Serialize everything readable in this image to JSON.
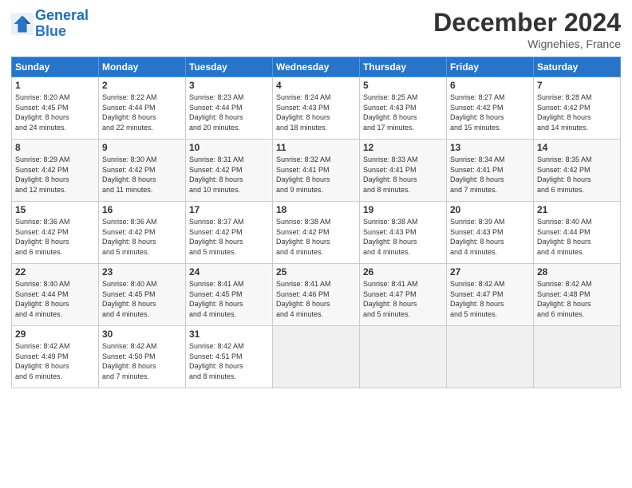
{
  "header": {
    "logo_line1": "General",
    "logo_line2": "Blue",
    "month": "December 2024",
    "location": "Wignehies, France"
  },
  "days_of_week": [
    "Sunday",
    "Monday",
    "Tuesday",
    "Wednesday",
    "Thursday",
    "Friday",
    "Saturday"
  ],
  "weeks": [
    [
      {
        "day": "1",
        "lines": [
          "Sunrise: 8:20 AM",
          "Sunset: 4:45 PM",
          "Daylight: 8 hours",
          "and 24 minutes."
        ]
      },
      {
        "day": "2",
        "lines": [
          "Sunrise: 8:22 AM",
          "Sunset: 4:44 PM",
          "Daylight: 8 hours",
          "and 22 minutes."
        ]
      },
      {
        "day": "3",
        "lines": [
          "Sunrise: 8:23 AM",
          "Sunset: 4:44 PM",
          "Daylight: 8 hours",
          "and 20 minutes."
        ]
      },
      {
        "day": "4",
        "lines": [
          "Sunrise: 8:24 AM",
          "Sunset: 4:43 PM",
          "Daylight: 8 hours",
          "and 18 minutes."
        ]
      },
      {
        "day": "5",
        "lines": [
          "Sunrise: 8:25 AM",
          "Sunset: 4:43 PM",
          "Daylight: 8 hours",
          "and 17 minutes."
        ]
      },
      {
        "day": "6",
        "lines": [
          "Sunrise: 8:27 AM",
          "Sunset: 4:42 PM",
          "Daylight: 8 hours",
          "and 15 minutes."
        ]
      },
      {
        "day": "7",
        "lines": [
          "Sunrise: 8:28 AM",
          "Sunset: 4:42 PM",
          "Daylight: 8 hours",
          "and 14 minutes."
        ]
      }
    ],
    [
      {
        "day": "8",
        "lines": [
          "Sunrise: 8:29 AM",
          "Sunset: 4:42 PM",
          "Daylight: 8 hours",
          "and 12 minutes."
        ]
      },
      {
        "day": "9",
        "lines": [
          "Sunrise: 8:30 AM",
          "Sunset: 4:42 PM",
          "Daylight: 8 hours",
          "and 11 minutes."
        ]
      },
      {
        "day": "10",
        "lines": [
          "Sunrise: 8:31 AM",
          "Sunset: 4:42 PM",
          "Daylight: 8 hours",
          "and 10 minutes."
        ]
      },
      {
        "day": "11",
        "lines": [
          "Sunrise: 8:32 AM",
          "Sunset: 4:41 PM",
          "Daylight: 8 hours",
          "and 9 minutes."
        ]
      },
      {
        "day": "12",
        "lines": [
          "Sunrise: 8:33 AM",
          "Sunset: 4:41 PM",
          "Daylight: 8 hours",
          "and 8 minutes."
        ]
      },
      {
        "day": "13",
        "lines": [
          "Sunrise: 8:34 AM",
          "Sunset: 4:41 PM",
          "Daylight: 8 hours",
          "and 7 minutes."
        ]
      },
      {
        "day": "14",
        "lines": [
          "Sunrise: 8:35 AM",
          "Sunset: 4:42 PM",
          "Daylight: 8 hours",
          "and 6 minutes."
        ]
      }
    ],
    [
      {
        "day": "15",
        "lines": [
          "Sunrise: 8:36 AM",
          "Sunset: 4:42 PM",
          "Daylight: 8 hours",
          "and 6 minutes."
        ]
      },
      {
        "day": "16",
        "lines": [
          "Sunrise: 8:36 AM",
          "Sunset: 4:42 PM",
          "Daylight: 8 hours",
          "and 5 minutes."
        ]
      },
      {
        "day": "17",
        "lines": [
          "Sunrise: 8:37 AM",
          "Sunset: 4:42 PM",
          "Daylight: 8 hours",
          "and 5 minutes."
        ]
      },
      {
        "day": "18",
        "lines": [
          "Sunrise: 8:38 AM",
          "Sunset: 4:42 PM",
          "Daylight: 8 hours",
          "and 4 minutes."
        ]
      },
      {
        "day": "19",
        "lines": [
          "Sunrise: 8:38 AM",
          "Sunset: 4:43 PM",
          "Daylight: 8 hours",
          "and 4 minutes."
        ]
      },
      {
        "day": "20",
        "lines": [
          "Sunrise: 8:39 AM",
          "Sunset: 4:43 PM",
          "Daylight: 8 hours",
          "and 4 minutes."
        ]
      },
      {
        "day": "21",
        "lines": [
          "Sunrise: 8:40 AM",
          "Sunset: 4:44 PM",
          "Daylight: 8 hours",
          "and 4 minutes."
        ]
      }
    ],
    [
      {
        "day": "22",
        "lines": [
          "Sunrise: 8:40 AM",
          "Sunset: 4:44 PM",
          "Daylight: 8 hours",
          "and 4 minutes."
        ]
      },
      {
        "day": "23",
        "lines": [
          "Sunrise: 8:40 AM",
          "Sunset: 4:45 PM",
          "Daylight: 8 hours",
          "and 4 minutes."
        ]
      },
      {
        "day": "24",
        "lines": [
          "Sunrise: 8:41 AM",
          "Sunset: 4:45 PM",
          "Daylight: 8 hours",
          "and 4 minutes."
        ]
      },
      {
        "day": "25",
        "lines": [
          "Sunrise: 8:41 AM",
          "Sunset: 4:46 PM",
          "Daylight: 8 hours",
          "and 4 minutes."
        ]
      },
      {
        "day": "26",
        "lines": [
          "Sunrise: 8:41 AM",
          "Sunset: 4:47 PM",
          "Daylight: 8 hours",
          "and 5 minutes."
        ]
      },
      {
        "day": "27",
        "lines": [
          "Sunrise: 8:42 AM",
          "Sunset: 4:47 PM",
          "Daylight: 8 hours",
          "and 5 minutes."
        ]
      },
      {
        "day": "28",
        "lines": [
          "Sunrise: 8:42 AM",
          "Sunset: 4:48 PM",
          "Daylight: 8 hours",
          "and 6 minutes."
        ]
      }
    ],
    [
      {
        "day": "29",
        "lines": [
          "Sunrise: 8:42 AM",
          "Sunset: 4:49 PM",
          "Daylight: 8 hours",
          "and 6 minutes."
        ]
      },
      {
        "day": "30",
        "lines": [
          "Sunrise: 8:42 AM",
          "Sunset: 4:50 PM",
          "Daylight: 8 hours",
          "and 7 minutes."
        ]
      },
      {
        "day": "31",
        "lines": [
          "Sunrise: 8:42 AM",
          "Sunset: 4:51 PM",
          "Daylight: 8 hours",
          "and 8 minutes."
        ]
      },
      null,
      null,
      null,
      null
    ]
  ]
}
